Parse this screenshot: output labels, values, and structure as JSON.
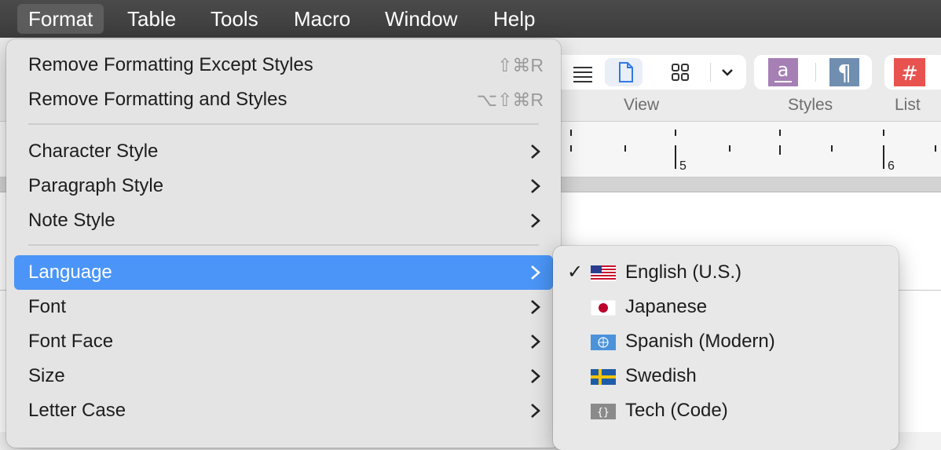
{
  "menubar": {
    "items": [
      {
        "label": "Format",
        "active": true
      },
      {
        "label": "Table"
      },
      {
        "label": "Tools"
      },
      {
        "label": "Macro"
      },
      {
        "label": "Window"
      },
      {
        "label": "Help"
      }
    ]
  },
  "toolbar": {
    "view_label": "View",
    "styles_label": "Styles",
    "list_label": "List"
  },
  "ruler": {
    "numbers": [
      "5",
      "6"
    ]
  },
  "format_menu": {
    "items": [
      {
        "label": "Remove Formatting Except Styles",
        "shortcut": "⇧⌘R"
      },
      {
        "label": "Remove Formatting and Styles",
        "shortcut": "⌥⇧⌘R"
      },
      {
        "label": "Character Style"
      },
      {
        "label": "Paragraph Style"
      },
      {
        "label": "Note Style"
      },
      {
        "label": "Language",
        "highlighted": true
      },
      {
        "label": "Font"
      },
      {
        "label": "Font Face"
      },
      {
        "label": "Size"
      },
      {
        "label": "Letter Case"
      }
    ]
  },
  "language_submenu": {
    "items": [
      {
        "label": "English (U.S.)",
        "checked": true,
        "icon": "us-flag-icon"
      },
      {
        "label": "Japanese",
        "icon": "japan-flag-icon"
      },
      {
        "label": "Spanish (Modern)",
        "icon": "un-flag-icon"
      },
      {
        "label": "Swedish",
        "icon": "sweden-flag-icon"
      },
      {
        "label": "Tech (Code)",
        "icon": "code-braces-icon"
      }
    ],
    "check_glyph": "✓"
  },
  "colors": {
    "menubar_bg": "#3f3f3f",
    "highlight": "#4a95f7",
    "char_style_button": "#a67fb5",
    "para_style_button": "#6f8eb0",
    "list_button": "#e8534f"
  }
}
